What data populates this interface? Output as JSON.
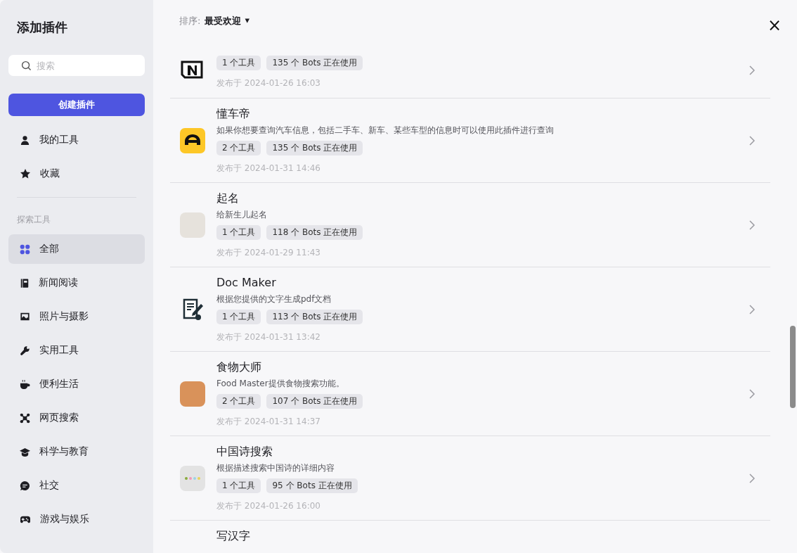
{
  "sidebar": {
    "title": "添加插件",
    "search": {
      "placeholder": "搜索"
    },
    "create_button": "创建插件",
    "top_items": [
      {
        "label": "我的工具",
        "selected": false
      },
      {
        "label": "收藏",
        "selected": false
      }
    ],
    "section_label": "探索工具",
    "items": [
      {
        "label": "全部",
        "selected": true
      },
      {
        "label": "新闻阅读",
        "selected": false
      },
      {
        "label": "照片与摄影",
        "selected": false
      },
      {
        "label": "实用工具",
        "selected": false
      },
      {
        "label": "便利生活",
        "selected": false
      },
      {
        "label": "网页搜索",
        "selected": false
      },
      {
        "label": "科学与教育",
        "selected": false
      },
      {
        "label": "社交",
        "selected": false
      },
      {
        "label": "游戏与娱乐",
        "selected": false
      }
    ]
  },
  "sort": {
    "label": "排序:",
    "value": "最受欢迎",
    "caret": "▾"
  },
  "close": "×",
  "plugins": [
    {
      "tags": [
        "1 个工具",
        "135 个 Bots 正在使用"
      ],
      "published": "发布于 2024-01-26 16:03"
    },
    {
      "title": "懂车帝",
      "description": "如果你想要查询汽车信息，包括二手车、新车、某些车型的信息时可以使用此插件进行查询",
      "tags": [
        "2 个工具",
        "135 个 Bots 正在使用"
      ],
      "published": "发布于 2024-01-31 14:46"
    },
    {
      "title": "起名",
      "description": "给新生儿起名",
      "tags": [
        "1 个工具",
        "118 个 Bots 正在使用"
      ],
      "published": "发布于 2024-01-29 11:43"
    },
    {
      "title": "Doc Maker",
      "description": "根据您提供的文字生成pdf文档",
      "tags": [
        "1 个工具",
        "113 个 Bots 正在使用"
      ],
      "published": "发布于 2024-01-31 13:42"
    },
    {
      "title": "食物大师",
      "description": "Food Master提供食物搜索功能。",
      "tags": [
        "2 个工具",
        "107 个 Bots 正在使用"
      ],
      "published": "发布于 2024-01-31 14:37"
    },
    {
      "title": "中国诗搜索",
      "description": "根据描述搜索中国诗的详细内容",
      "tags": [
        "1 个工具",
        "95 个 Bots 正在使用"
      ],
      "published": "发布于 2024-01-26 16:00"
    },
    {
      "title": "写汉字"
    }
  ]
}
